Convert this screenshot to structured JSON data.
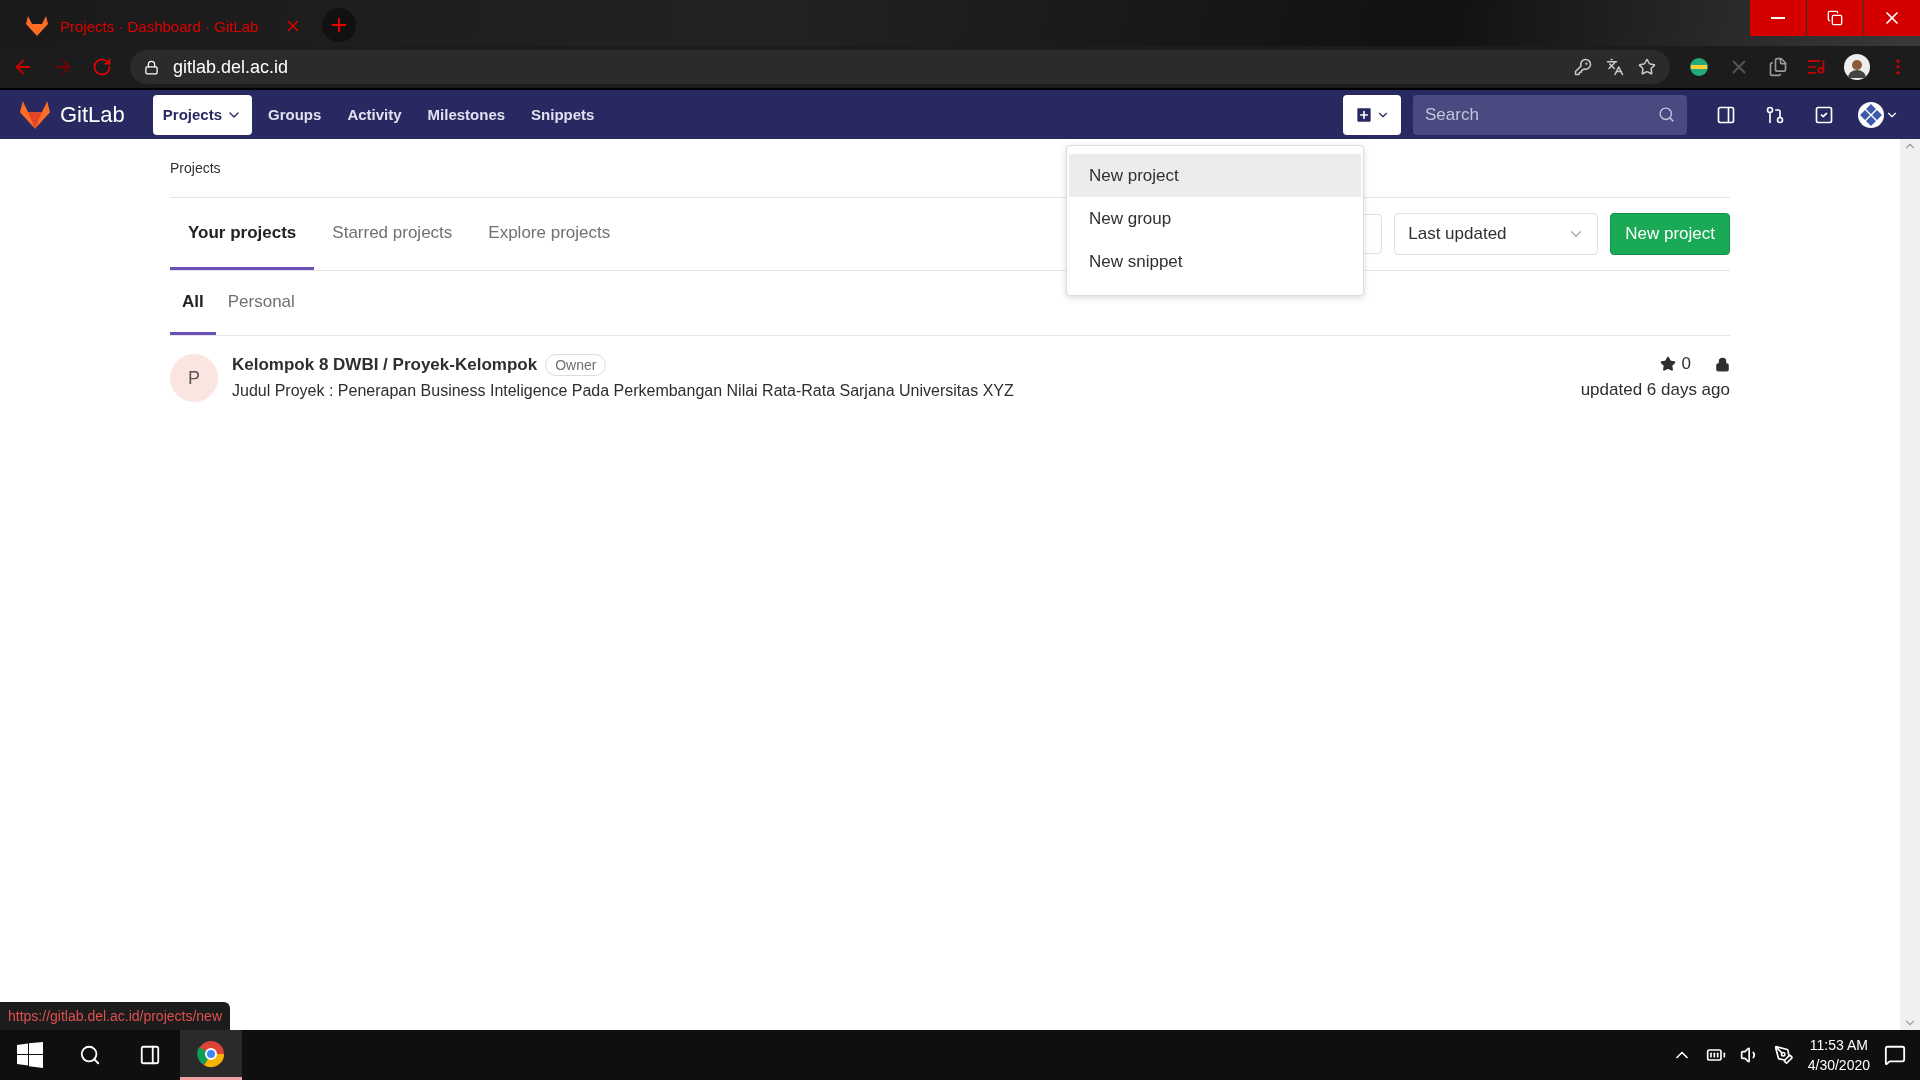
{
  "browser": {
    "tab_title": "Projects · Dashboard · GitLab",
    "url": "gitlab.del.ac.id",
    "status_url": "https://gitlab.del.ac.id/projects/new"
  },
  "nav": {
    "brand": "GitLab",
    "items": [
      {
        "label": "Projects",
        "selected": true
      },
      {
        "label": "Groups",
        "selected": false
      },
      {
        "label": "Activity",
        "selected": false
      },
      {
        "label": "Milestones",
        "selected": false
      },
      {
        "label": "Snippets",
        "selected": false
      }
    ],
    "search_placeholder": "Search"
  },
  "breadcrumb": "Projects",
  "tabs": [
    {
      "label": "Your projects",
      "selected": true
    },
    {
      "label": "Starred projects",
      "selected": false
    },
    {
      "label": "Explore projects",
      "selected": false
    }
  ],
  "subtabs": [
    {
      "label": "All",
      "selected": true
    },
    {
      "label": "Personal",
      "selected": false
    }
  ],
  "sort": "Last updated",
  "new_button": "New project",
  "new_menu": [
    {
      "label": "New project",
      "selected": true
    },
    {
      "label": "New group",
      "selected": false
    },
    {
      "label": "New snippet",
      "selected": false
    }
  ],
  "projects": [
    {
      "avatar": "P",
      "name": "Kelompok 8 DWBI / Proyek-Kelompok",
      "role": "Owner",
      "description": "Judul Proyek : Penerapan Business Inteligence Pada Perkembangan Nilai Rata-Rata Sarjana Universitas XYZ",
      "stars": "0",
      "private": true,
      "updated": "updated 6 days ago"
    }
  ],
  "taskbar": {
    "time": "11:53 AM",
    "date": "4/30/2020"
  }
}
